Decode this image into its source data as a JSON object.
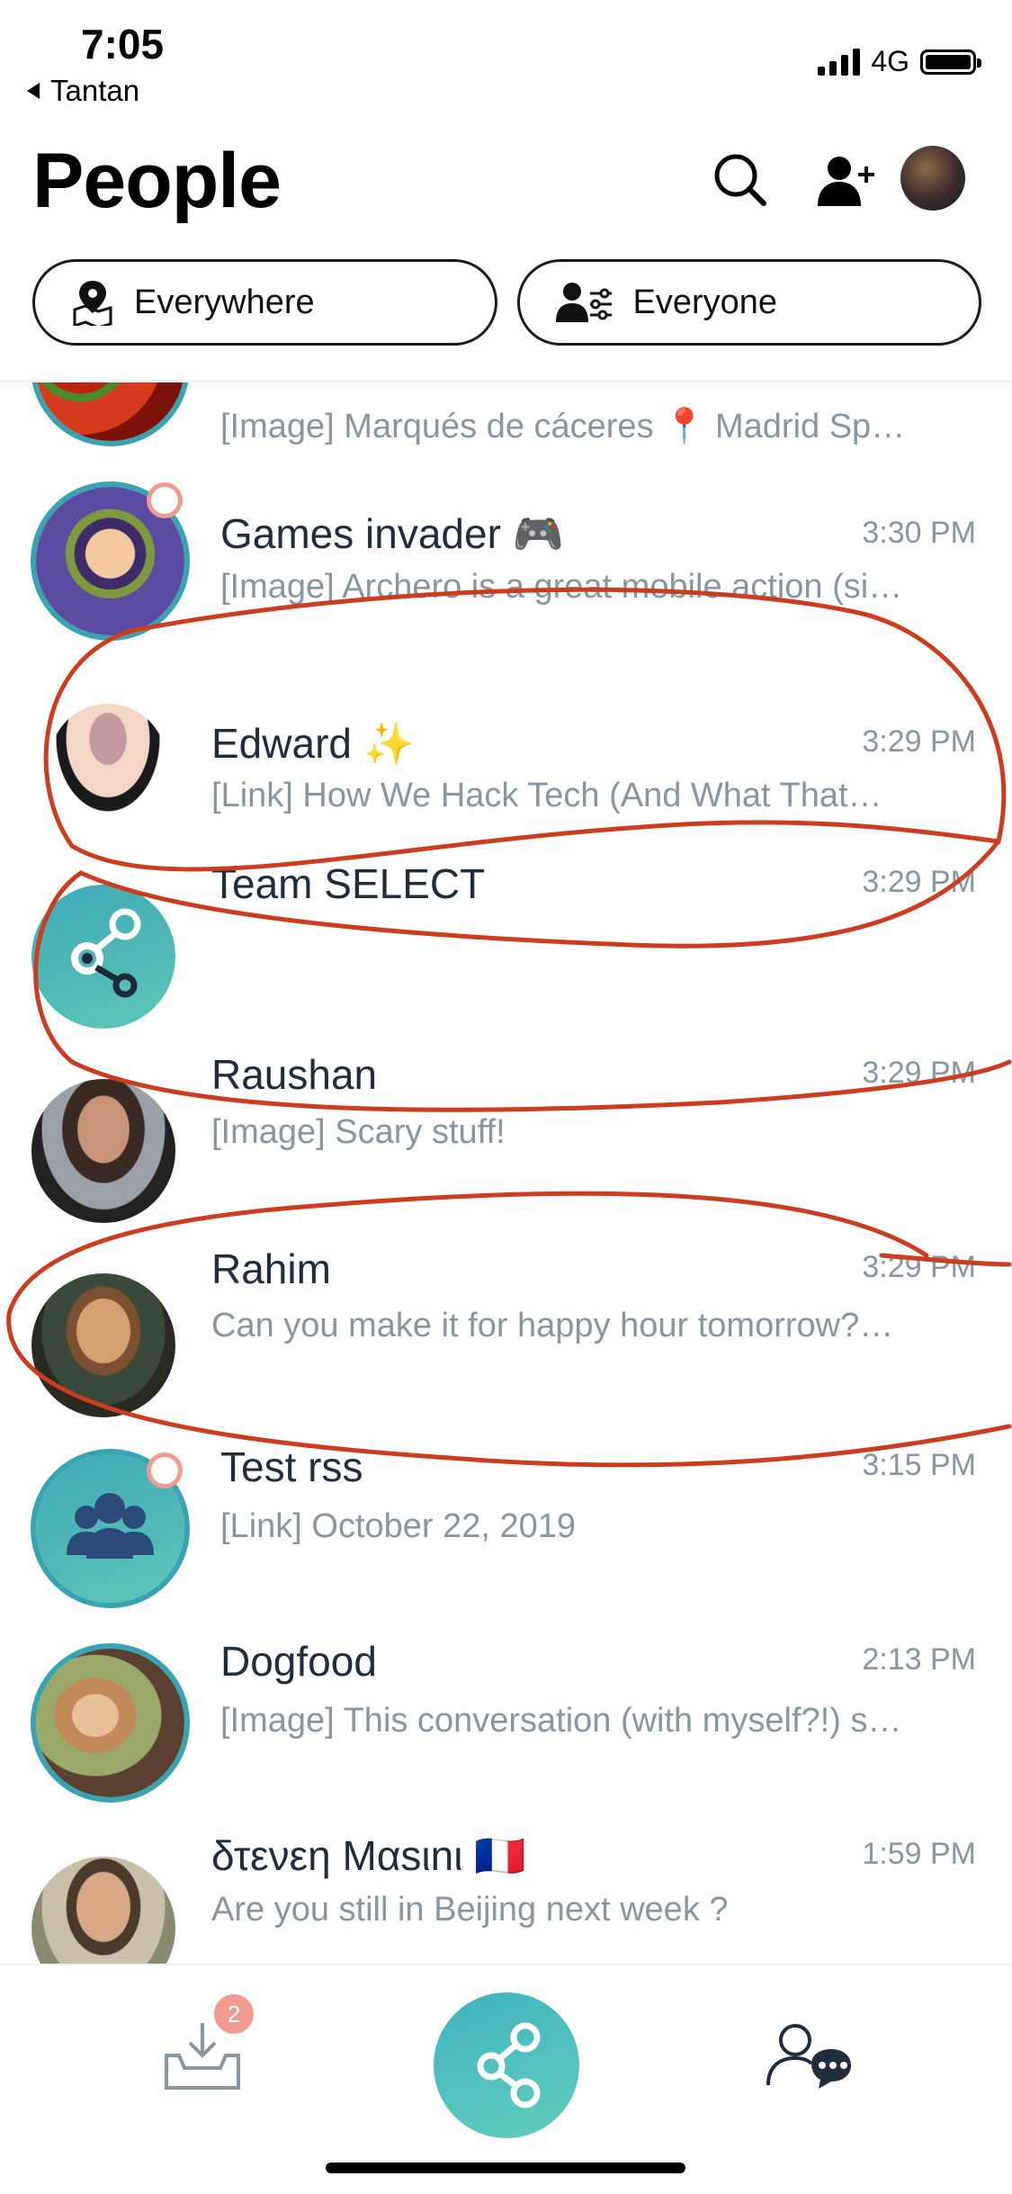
{
  "status_bar": {
    "time": "7:05",
    "back_app": "Tantan",
    "network": "4G"
  },
  "header": {
    "title": "People"
  },
  "filters": [
    {
      "label": "Everywhere",
      "icon": "map-pin-icon"
    },
    {
      "label": "Everyone",
      "icon": "people-filter-icon"
    }
  ],
  "conversations": [
    {
      "name": "",
      "time": "",
      "preview": "[Image] Marqués de cáceres 📍 Madrid Sp…"
    },
    {
      "name": "Games invader 🎮",
      "time": "3:30 PM",
      "preview": "[Image] Archero is a great mobile action (si…"
    },
    {
      "name": "Edward ✨",
      "time": "3:29 PM",
      "preview": "[Link] How We Hack Tech (And What That…"
    },
    {
      "name": "Team SELECT",
      "time": "3:29 PM",
      "preview": ""
    },
    {
      "name": "Raushan",
      "time": "3:29 PM",
      "preview": "[Image] Scary stuff!"
    },
    {
      "name": "Rahim",
      "time": "3:29 PM",
      "preview": "Can you make it for happy hour tomorrow?…"
    },
    {
      "name": "Test rss",
      "time": "3:15 PM",
      "preview": "[Link] October 22, 2019"
    },
    {
      "name": "Dogfood",
      "time": "2:13 PM",
      "preview": "[Image] This conversation (with myself?!) s…"
    },
    {
      "name": "δτενεη Mαsιnι 🇫🇷",
      "time": "1:59 PM",
      "preview": "Are you still in Beijing next week ?"
    }
  ],
  "tabbar": {
    "inbox_badge": "2"
  },
  "colors": {
    "teal": "#38a3b1",
    "badge": "#f19a92",
    "annotation": "#cc3d1f",
    "muted_text": "#8896a0"
  }
}
